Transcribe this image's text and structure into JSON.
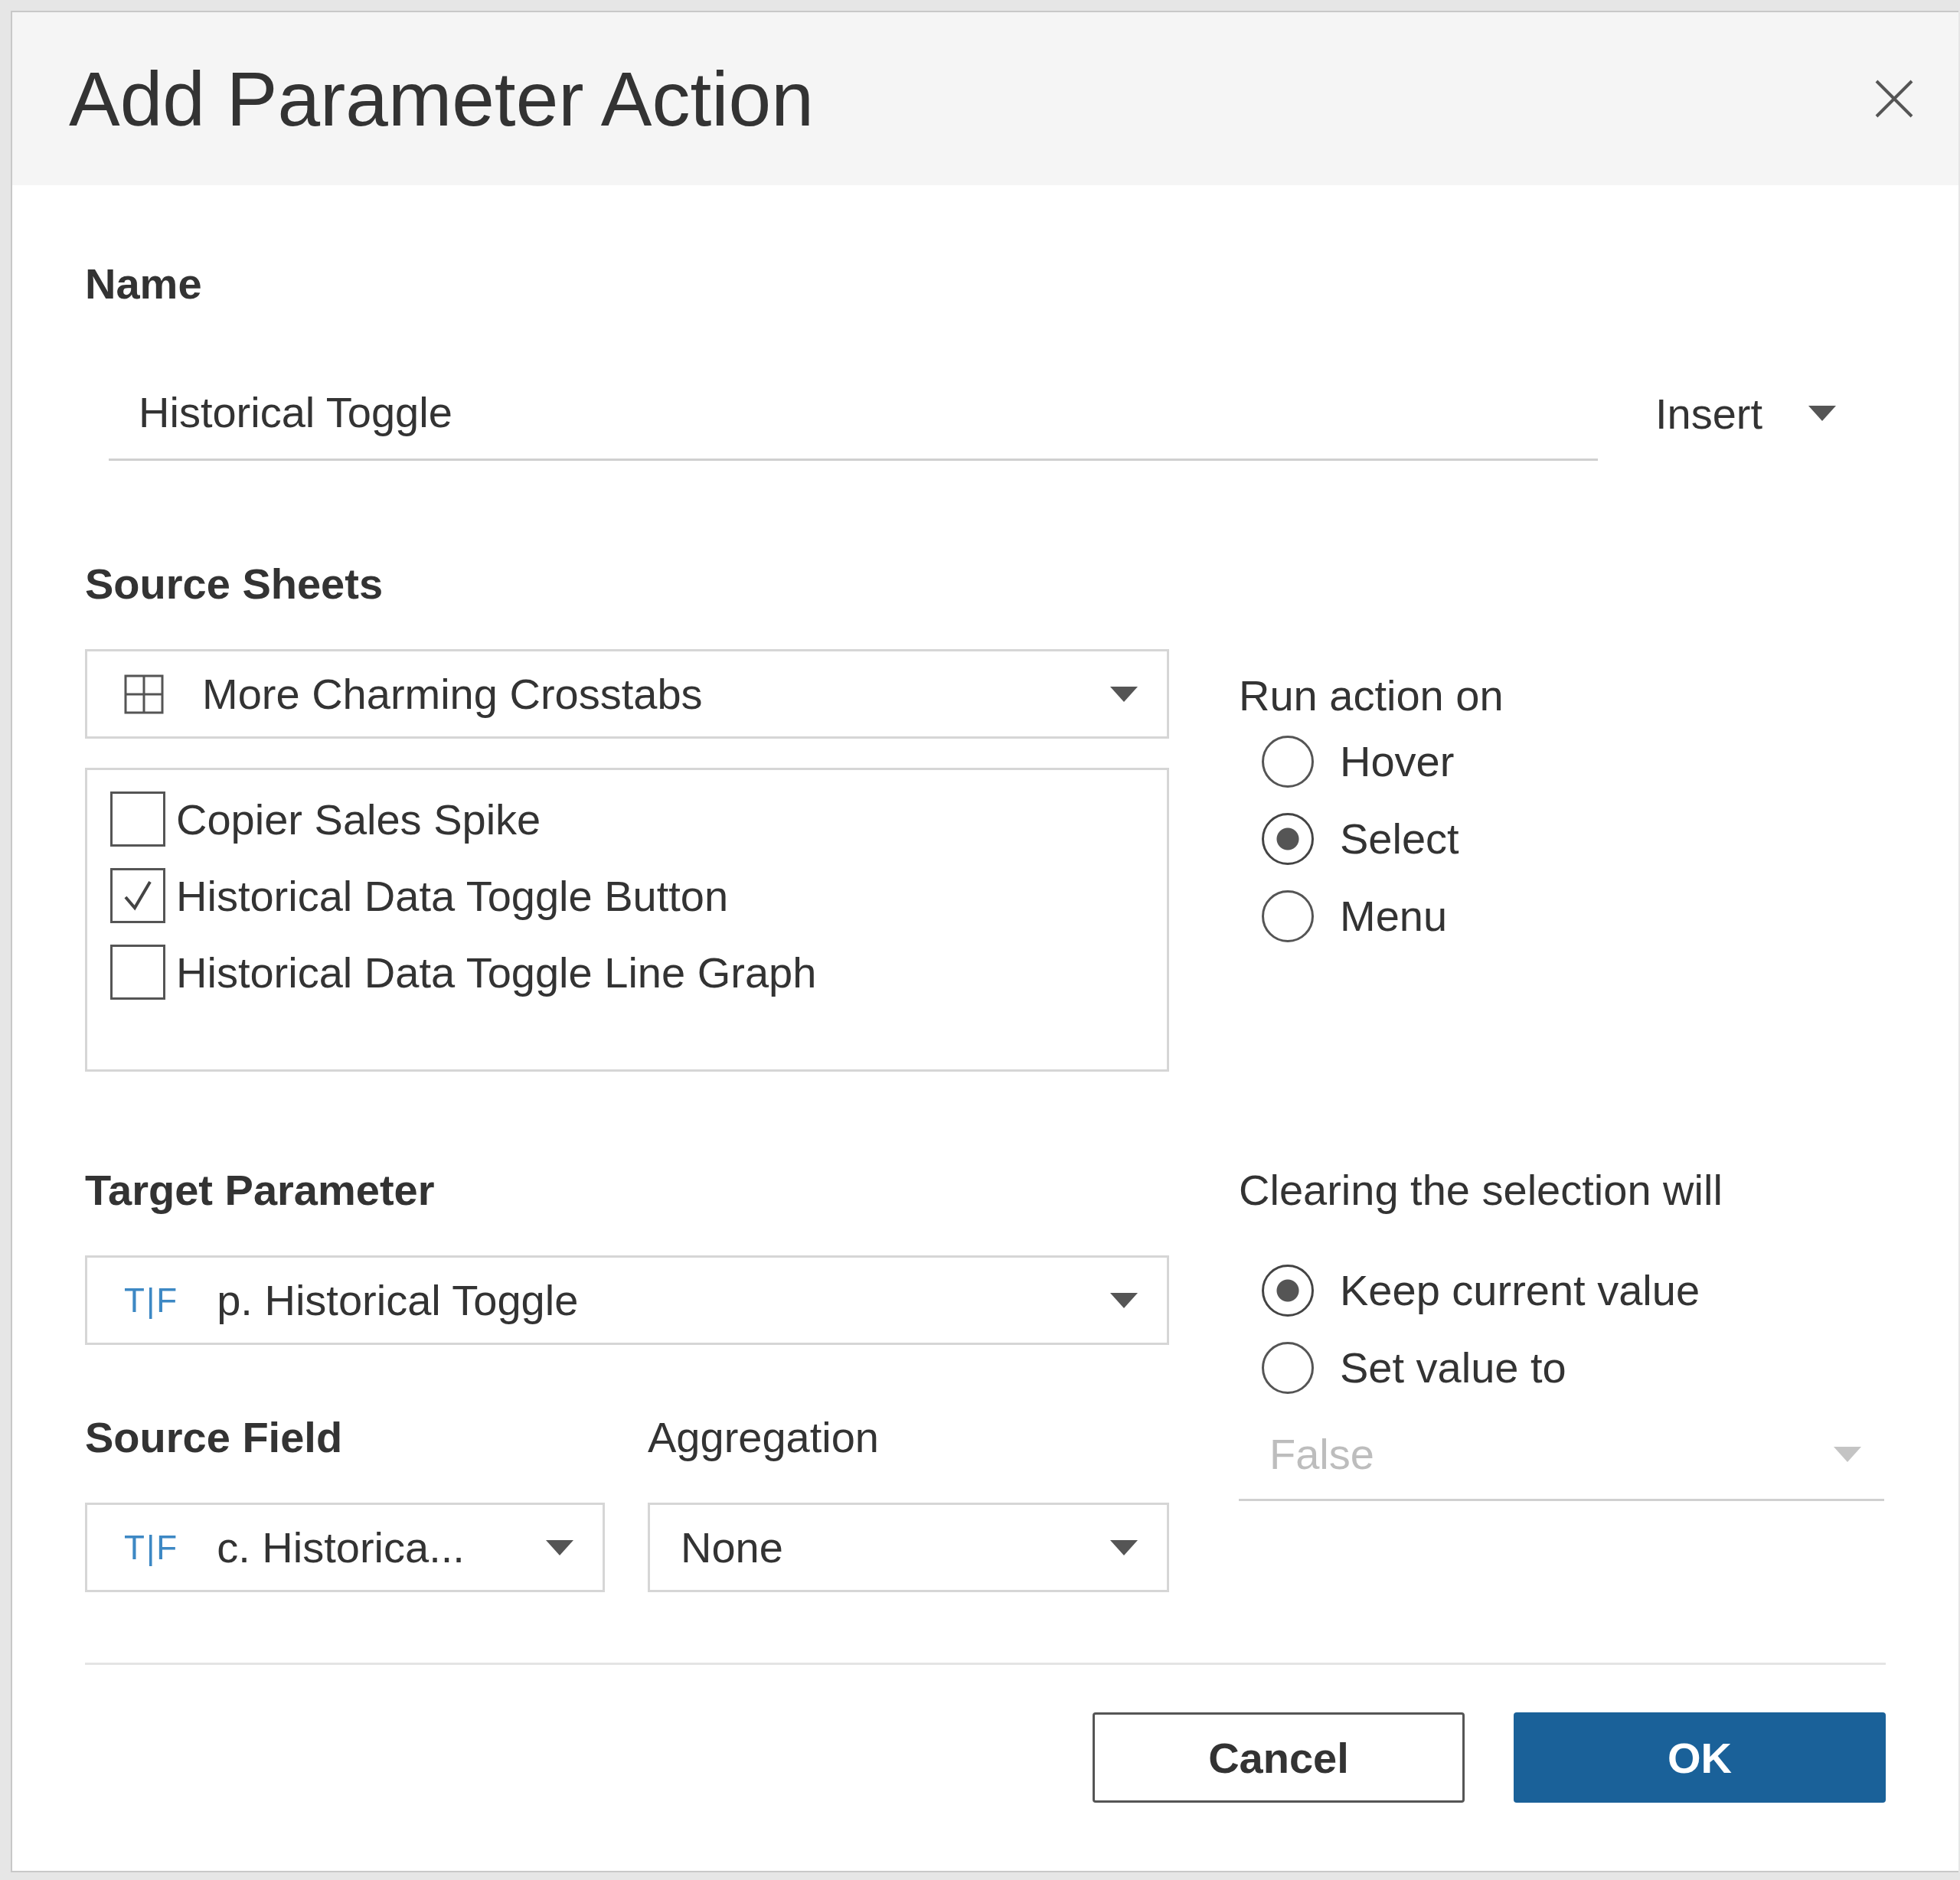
{
  "dialog": {
    "title": "Add Parameter Action"
  },
  "name": {
    "label": "Name",
    "value": "Historical Toggle",
    "insert_button": "Insert"
  },
  "source_sheets": {
    "label": "Source Sheets",
    "dashboard": "More Charming Crosstabs",
    "sheets": [
      {
        "label": "Copier Sales Spike",
        "checked": false
      },
      {
        "label": "Historical Data Toggle Button",
        "checked": true
      },
      {
        "label": "Historical Data Toggle Line Graph",
        "checked": false
      }
    ]
  },
  "run_action_on": {
    "label": "Run action on",
    "options": [
      {
        "label": "Hover",
        "selected": false
      },
      {
        "label": "Select",
        "selected": true
      },
      {
        "label": "Menu",
        "selected": false
      }
    ]
  },
  "target_parameter": {
    "label": "Target Parameter",
    "type_icon": "T|F",
    "value": "p. Historical Toggle"
  },
  "source_field": {
    "label": "Source Field",
    "type_icon": "T|F",
    "value": "c. Historica..."
  },
  "aggregation": {
    "label": "Aggregation",
    "value": "None"
  },
  "clearing": {
    "label": "Clearing the selection will",
    "options": [
      {
        "label": "Keep current value",
        "selected": true
      },
      {
        "label": "Set value to",
        "selected": false
      }
    ],
    "set_value": {
      "value": "False",
      "disabled": true
    }
  },
  "buttons": [
    {
      "label": "Cancel",
      "kind": "secondary"
    },
    {
      "label": "OK",
      "kind": "primary"
    }
  ]
}
